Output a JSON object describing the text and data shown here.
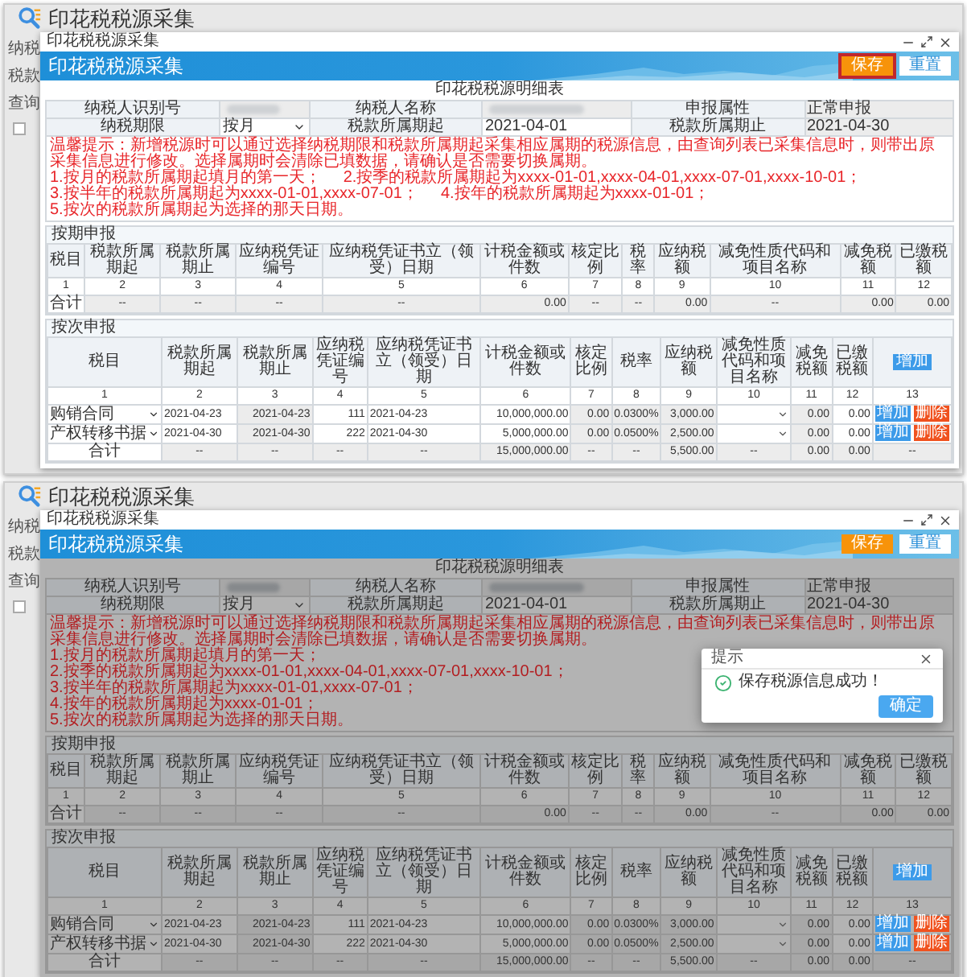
{
  "panels": [
    {
      "dimmed": false,
      "page": {
        "title": "印花税税源采集",
        "background_labels": [
          "纳税",
          "税款",
          "查询"
        ],
        "checkbox_checked": false
      },
      "dialog": {
        "window_title": "印花税税源采集",
        "header_title": "印花税税源采集",
        "buttons": [
          {
            "label": "保存",
            "kind": "primary",
            "highlighted": true
          },
          {
            "label": "重置",
            "kind": "secondary",
            "highlighted": false
          }
        ],
        "sheet_title": "印花税税源明细表",
        "info_rows": [
          [
            {
              "label": "纳税人识别号",
              "kind": "blurred",
              "editable": false
            },
            {
              "label": "纳税人名称",
              "kind": "blurred",
              "editable": false
            },
            {
              "label": "申报属性",
              "kind": "text",
              "value": "正常申报",
              "editable": false
            }
          ],
          [
            {
              "label": "纳税期限",
              "kind": "select",
              "value": "按月",
              "editable": true
            },
            {
              "label": "税款所属期起",
              "kind": "text",
              "value": "2021-04-01",
              "editable": true
            },
            {
              "label": "税款所属期止",
              "kind": "text",
              "value": "2021-04-30",
              "editable": false
            }
          ]
        ],
        "notice": [
          "温馨提示：新增税源时可以通过选择纳税期限和税款所属期起采集相应属期的税源信息，由查询列表已采集信息时，则带出原采集信息进行修改。选择属期时会清除已填数据，请确认是否需要切换属期。",
          "1.按月的税款所属期起填月的第一天；",
          "2.按季的税款所属期起为xxxx-01-01,xxxx-04-01,xxxx-07-01,xxxx-10-01；",
          "3.按半年的税款所属期起为xxxx-01-01,xxxx-07-01；",
          "4.按年的税款所属期起为xxxx-01-01；",
          "5.按次的税款所属期起为选择的那天日期。"
        ],
        "periodic": {
          "title": "按期申报",
          "columns": [
            "税目",
            "税款所属期起",
            "税款所属期止",
            "应纳税凭证编号",
            "应纳税凭证书立（领受）日期",
            "计税金额或件数",
            "核定比例",
            "税率",
            "应纳税额",
            "减免性质代码和项目名称",
            "减免税额",
            "已缴税额"
          ],
          "index": [
            "1",
            "2",
            "3",
            "4",
            "5",
            "6",
            "7",
            "8",
            "9",
            "10",
            "11",
            "12"
          ],
          "total": [
            "合计",
            "--",
            "--",
            "--",
            "--",
            "0.00",
            "--",
            "--",
            "0.00",
            "--",
            "0.00",
            "0.00"
          ]
        },
        "per_use": {
          "title": "按次申报",
          "columns": [
            {
              "label": "税目",
              "editable": true
            },
            {
              "label": "税款所属期起",
              "editable": true
            },
            {
              "label": "税款所属期止",
              "editable": false
            },
            {
              "label": "应纳税凭证编号",
              "editable": true
            },
            {
              "label": "应纳税凭证书立（领受）日期",
              "editable": true
            },
            {
              "label": "计税金额或件数",
              "editable": true
            },
            {
              "label": "核定比例",
              "editable": false
            },
            {
              "label": "税率",
              "editable": false
            },
            {
              "label": "应纳税额",
              "editable": false
            },
            {
              "label": "减免性质代码和项目名称",
              "editable": true
            },
            {
              "label": "减免税额",
              "editable": false
            },
            {
              "label": "已缴税额",
              "editable": true
            }
          ],
          "add_button": "增加",
          "index": [
            "1",
            "2",
            "3",
            "4",
            "5",
            "6",
            "7",
            "8",
            "9",
            "10",
            "11",
            "12",
            "13"
          ],
          "rows": [
            {
              "tax_item": "购销合同",
              "values": [
                "2021-04-23",
                "2021-04-23",
                "111",
                "2021-04-23",
                "10,000,000.00",
                "0.00",
                "0.0300%",
                "3,000.00"
              ],
              "after": [
                "0.00",
                "0.00"
              ],
              "actions": [
                {
                  "label": "增加",
                  "kind": "add"
                },
                {
                  "label": "删除",
                  "kind": "delete"
                }
              ]
            },
            {
              "tax_item": "产权转移书据",
              "values": [
                "2021-04-30",
                "2021-04-30",
                "222",
                "2021-04-30",
                "5,000,000.00",
                "0.00",
                "0.0500%",
                "2,500.00"
              ],
              "after": [
                "0.00",
                "0.00"
              ],
              "actions": [
                {
                  "label": "增加",
                  "kind": "add"
                },
                {
                  "label": "删除",
                  "kind": "delete"
                }
              ]
            }
          ],
          "total": [
            "合计",
            "--",
            "--",
            "--",
            "--",
            "15,000,000.00",
            "--",
            "--",
            "5,500.00",
            "--",
            "0.00",
            "0.00",
            "--"
          ]
        }
      }
    },
    {
      "dimmed": true,
      "page": {
        "title": "印花税税源采集",
        "background_labels": [
          "纳税",
          "税款",
          "查询"
        ],
        "checkbox_checked": false
      },
      "dialog": {
        "window_title": "印花税税源采集",
        "header_title": "印花税税源采集",
        "buttons": [
          {
            "label": "保存",
            "kind": "primary",
            "highlighted": false
          },
          {
            "label": "重置",
            "kind": "secondary",
            "highlighted": false
          }
        ],
        "sheet_title": "印花税税源明细表",
        "info_rows": [
          [
            {
              "label": "纳税人识别号",
              "kind": "blurred",
              "editable": false
            },
            {
              "label": "纳税人名称",
              "kind": "blurred",
              "editable": false
            },
            {
              "label": "申报属性",
              "kind": "text",
              "value": "正常申报",
              "editable": false
            }
          ],
          [
            {
              "label": "纳税期限",
              "kind": "select",
              "value": "按月",
              "editable": true
            },
            {
              "label": "税款所属期起",
              "kind": "text",
              "value": "2021-04-01",
              "editable": true
            },
            {
              "label": "税款所属期止",
              "kind": "text",
              "value": "2021-04-30",
              "editable": false
            }
          ]
        ],
        "notice": [
          "温馨提示：新增税源时可以通过选择纳税期限和税款所属期起采集相应属期的税源信息，由查询列表已采集信息时，则带出原采集信息进行修改。选择属期时会清除已填数据，请确认是否需要切换属期。",
          "1.按月的税款所属期起填月的第一天；",
          "2.按季的税款所属期起为xxxx-01-01,xxxx-04-01,xxxx-07-01,xxxx-10-01；",
          "3.按半年的税款所属期起为xxxx-01-01,xxxx-07-01；",
          "4.按年的税款所属期起为xxxx-01-01；",
          "5.按次的税款所属期起为选择的那天日期。"
        ],
        "periodic": {
          "title": "按期申报",
          "columns": [
            "税目",
            "税款所属期起",
            "税款所属期止",
            "应纳税凭证编号",
            "应纳税凭证书立（领受）日期",
            "计税金额或件数",
            "核定比例",
            "税率",
            "应纳税额",
            "减免性质代码和项目名称",
            "减免税额",
            "已缴税额"
          ],
          "index": [
            "1",
            "2",
            "3",
            "4",
            "5",
            "6",
            "7",
            "8",
            "9",
            "10",
            "11",
            "12"
          ],
          "total": [
            "合计",
            "--",
            "--",
            "--",
            "--",
            "0.00",
            "--",
            "--",
            "0.00",
            "--",
            "0.00",
            "0.00"
          ]
        },
        "per_use": {
          "title": "按次申报",
          "columns": [
            {
              "label": "税目",
              "editable": true
            },
            {
              "label": "税款所属期起",
              "editable": true
            },
            {
              "label": "税款所属期止",
              "editable": false
            },
            {
              "label": "应纳税凭证编号",
              "editable": true
            },
            {
              "label": "应纳税凭证书立（领受）日期",
              "editable": true
            },
            {
              "label": "计税金额或件数",
              "editable": true
            },
            {
              "label": "核定比例",
              "editable": false
            },
            {
              "label": "税率",
              "editable": false
            },
            {
              "label": "应纳税额",
              "editable": false
            },
            {
              "label": "减免性质代码和项目名称",
              "editable": true
            },
            {
              "label": "减免税额",
              "editable": false
            },
            {
              "label": "已缴税额",
              "editable": true
            }
          ],
          "add_button": "增加",
          "index": [
            "1",
            "2",
            "3",
            "4",
            "5",
            "6",
            "7",
            "8",
            "9",
            "10",
            "11",
            "12",
            "13"
          ],
          "rows": [
            {
              "tax_item": "购销合同",
              "values": [
                "2021-04-23",
                "2021-04-23",
                "111",
                "2021-04-23",
                "10,000,000.00",
                "0.00",
                "0.0300%",
                "3,000.00"
              ],
              "after": [
                "0.00",
                "0.00"
              ],
              "actions": [
                {
                  "label": "增加",
                  "kind": "add"
                },
                {
                  "label": "删除",
                  "kind": "delete"
                }
              ]
            },
            {
              "tax_item": "产权转移书据",
              "values": [
                "2021-04-30",
                "2021-04-30",
                "222",
                "2021-04-30",
                "5,000,000.00",
                "0.00",
                "0.0500%",
                "2,500.00"
              ],
              "after": [
                "0.00",
                "0.00"
              ],
              "actions": [
                {
                  "label": "增加",
                  "kind": "add"
                },
                {
                  "label": "删除",
                  "kind": "delete"
                }
              ]
            }
          ],
          "total": [
            "合计",
            "--",
            "--",
            "--",
            "--",
            "15,000,000.00",
            "--",
            "--",
            "5,500.00",
            "--",
            "0.00",
            "0.00",
            "--"
          ]
        }
      },
      "modal": {
        "title": "提示",
        "message": "保存税源信息成功！",
        "button": "确定"
      }
    }
  ]
}
